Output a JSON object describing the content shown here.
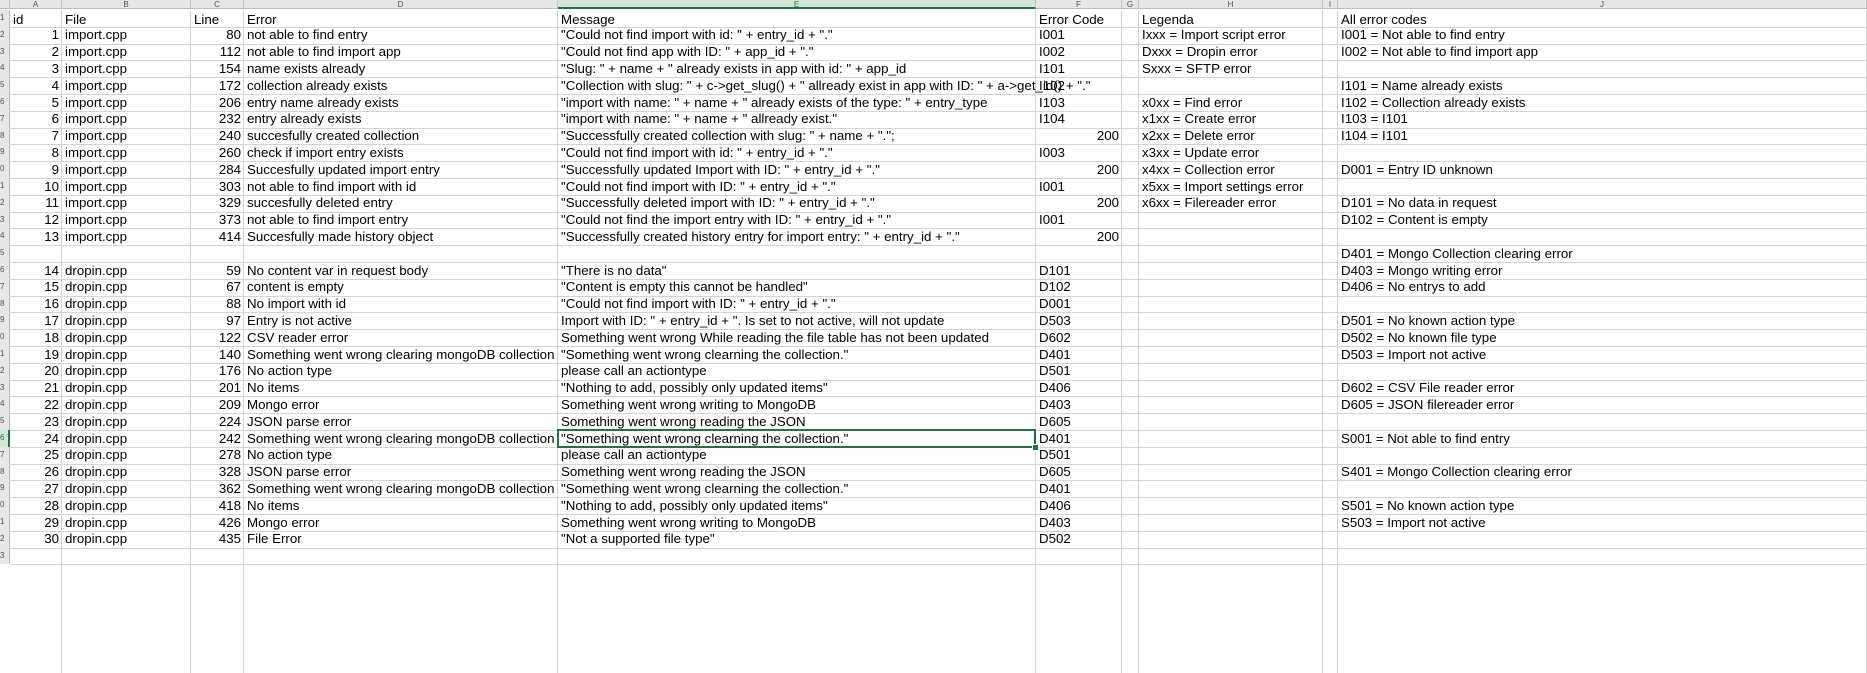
{
  "spreadsheet": {
    "column_letters": [
      "A",
      "B",
      "C",
      "D",
      "E",
      "F",
      "G",
      "H",
      "I",
      "J"
    ],
    "selected_column": "E",
    "selected_row": 26,
    "row_numbers": [
      "1",
      "2",
      "3",
      "4",
      "5",
      "6",
      "7",
      "8",
      "9",
      "0",
      "1",
      "2",
      "3",
      "4",
      "5",
      "6",
      "7",
      "8",
      "9",
      "0",
      "1",
      "2",
      "3",
      "4",
      "5",
      "6",
      "7",
      "8",
      "9",
      "0",
      "1",
      "2",
      "3"
    ],
    "headers": {
      "id": "id",
      "file": "File",
      "line": "Line",
      "error": "Error",
      "message": "Message",
      "error_code": "Error Code",
      "legenda": "Legenda",
      "all_error_codes": "All error codes"
    },
    "colors": {
      "accent": "#217346",
      "header_bg": "#e6e6e6",
      "grid": "#d4d4d4"
    },
    "rows": [
      {
        "id": "1",
        "file": "import.cpp",
        "line": "80",
        "error": "not able to find entry",
        "message": "\"Could not find import with id: \" + entry_id + \".\"",
        "code": "I001",
        "status": "",
        "legenda": "Ixxx = Import script error",
        "all": "I001 = Not able to find entry"
      },
      {
        "id": "2",
        "file": "import.cpp",
        "line": "112",
        "error": "not able to find import app",
        "message": "\"Could not find app with ID: \" + app_id + \".\"",
        "code": "I002",
        "status": "",
        "legenda": "Dxxx = Dropin error",
        "all": "I002 = Not able to find import app"
      },
      {
        "id": "3",
        "file": "import.cpp",
        "line": "154",
        "error": "name exists already",
        "message": "\"Slug: \" + name + \" already exists in app with id: \" + app_id",
        "code": "I101",
        "status": "",
        "legenda": "Sxxx = SFTP error",
        "all": ""
      },
      {
        "id": "4",
        "file": "import.cpp",
        "line": "172",
        "error": "collection already exists",
        "message": "\"Collection with slug: \" + c->get_slug() + \" allready exist in app with ID: \" + a->get_id() + \".\"",
        "code": "I102",
        "status": "",
        "legenda": "",
        "all": "I101 = Name already exists"
      },
      {
        "id": "5",
        "file": "import.cpp",
        "line": "206",
        "error": "entry name already exists",
        "message": "\"import with name: \" + name + \" already exists of the type: \" + entry_type",
        "code": "I103",
        "status": "",
        "legenda": "x0xx = Find error",
        "all": "I102 = Collection already exists"
      },
      {
        "id": "6",
        "file": "import.cpp",
        "line": "232",
        "error": "entry already exists",
        "message": "\"import with name: \" + name + \" allready exist.\"",
        "code": "I104",
        "status": "",
        "legenda": "x1xx = Create error",
        "all": "I103 = I101"
      },
      {
        "id": "7",
        "file": "import.cpp",
        "line": "240",
        "error": "succesfully created collection",
        "message": "\"Successfully created collection with slug: \" + name + \".\";",
        "code": "",
        "status": "200",
        "legenda": "x2xx = Delete error",
        "all": "I104 = I101"
      },
      {
        "id": "8",
        "file": "import.cpp",
        "line": "260",
        "error": "check if import entry exists",
        "message": "\"Could not find import with id: \" + entry_id + \".\"",
        "code": "I003",
        "status": "",
        "legenda": "x3xx = Update error",
        "all": ""
      },
      {
        "id": "9",
        "file": "import.cpp",
        "line": "284",
        "error": "Succesfully updated import entry",
        "message": "\"Successfully updated Import with ID: \" + entry_id + \".\"",
        "code": "",
        "status": "200",
        "legenda": "x4xx = Collection error",
        "all": "D001 = Entry ID unknown"
      },
      {
        "id": "10",
        "file": "import.cpp",
        "line": "303",
        "error": "not able to find import with id",
        "message": "\"Could not find import with ID: \" + entry_id + \".\"",
        "code": "I001",
        "status": "",
        "legenda": "x5xx = Import settings error",
        "all": ""
      },
      {
        "id": "11",
        "file": "import.cpp",
        "line": "329",
        "error": "succesfully deleted entry",
        "message": "\"Successfully deleted import with ID: \" + entry_id + \".\"",
        "code": "",
        "status": "200",
        "legenda": "x6xx = Filereader error",
        "all": "D101 = No data in request"
      },
      {
        "id": "12",
        "file": "import.cpp",
        "line": "373",
        "error": "not able to find import entry",
        "message": "\"Could not find the import entry with ID: \" + entry_id + \".\"",
        "code": "I001",
        "status": "",
        "legenda": "",
        "all": "D102 = Content is empty"
      },
      {
        "id": "13",
        "file": "import.cpp",
        "line": "414",
        "error": "Succesfully made history object",
        "message": "\"Successfully created history entry for import entry: \" + entry_id + \".\"",
        "code": "",
        "status": "200",
        "legenda": "",
        "all": ""
      },
      {
        "id": "",
        "file": "",
        "line": "",
        "error": "",
        "message": "",
        "code": "",
        "status": "",
        "legenda": "",
        "all": "D401 = Mongo Collection clearing error"
      },
      {
        "id": "14",
        "file": "dropin.cpp",
        "line": "59",
        "error": "No content var in request body",
        "message": "\"There is no data\"",
        "code": "D101",
        "status": "",
        "legenda": "",
        "all": "D403 = Mongo writing error"
      },
      {
        "id": "15",
        "file": "dropin.cpp",
        "line": "67",
        "error": "content is empty",
        "message": "\"Content is empty this cannot be handled\"",
        "code": "D102",
        "status": "",
        "legenda": "",
        "all": "D406 = No entrys to add"
      },
      {
        "id": "16",
        "file": "dropin.cpp",
        "line": "88",
        "error": "No import with id",
        "message": "\"Could not find import with ID: \" + entry_id + \".\"",
        "code": "D001",
        "status": "",
        "legenda": "",
        "all": ""
      },
      {
        "id": "17",
        "file": "dropin.cpp",
        "line": "97",
        "error": "Entry is not active",
        "message": "Import with ID: \" + entry_id + \". Is set to not active, will not update",
        "code": "D503",
        "status": "",
        "legenda": "",
        "all": "D501 = No known action type"
      },
      {
        "id": "18",
        "file": "dropin.cpp",
        "line": "122",
        "error": "CSV reader error",
        "message": "Something went wrong While reading the file table has not been updated",
        "code": "D602",
        "status": "",
        "legenda": "",
        "all": "D502 = No known file type"
      },
      {
        "id": "19",
        "file": "dropin.cpp",
        "line": "140",
        "error": "Something went wrong clearing mongoDB collection",
        "message": "\"Something went wrong clearning the collection.\"",
        "code": "D401",
        "status": "",
        "legenda": "",
        "all": "D503 = Import not active"
      },
      {
        "id": "20",
        "file": "dropin.cpp",
        "line": "176",
        "error": "No action type",
        "message": "please call an actiontype",
        "code": "D501",
        "status": "",
        "legenda": "",
        "all": ""
      },
      {
        "id": "21",
        "file": "dropin.cpp",
        "line": "201",
        "error": "No items",
        "message": "\"Nothing to add, possibly only updated items\"",
        "code": "D406",
        "status": "",
        "legenda": "",
        "all": "D602 = CSV File reader error"
      },
      {
        "id": "22",
        "file": "dropin.cpp",
        "line": "209",
        "error": "Mongo error",
        "message": "Something went wrong writing to MongoDB",
        "code": "D403",
        "status": "",
        "legenda": "",
        "all": "D605 = JSON filereader error"
      },
      {
        "id": "23",
        "file": "dropin.cpp",
        "line": "224",
        "error": "JSON parse error",
        "message": "Something went wrong reading the JSON",
        "code": "D605",
        "status": "",
        "legenda": "",
        "all": ""
      },
      {
        "id": "24",
        "file": "dropin.cpp",
        "line": "242",
        "error": "Something went wrong clearing mongoDB collection",
        "message": "\"Something went wrong clearning the collection.\"",
        "code": "D401",
        "status": "",
        "legenda": "",
        "all": "S001 = Not able to find entry"
      },
      {
        "id": "25",
        "file": "dropin.cpp",
        "line": "278",
        "error": "No action type",
        "message": "please call an actiontype",
        "code": "D501",
        "status": "",
        "legenda": "",
        "all": ""
      },
      {
        "id": "26",
        "file": "dropin.cpp",
        "line": "328",
        "error": "JSON parse error",
        "message": "Something went wrong reading the JSON",
        "code": "D605",
        "status": "",
        "legenda": "",
        "all": "S401 = Mongo Collection clearing error"
      },
      {
        "id": "27",
        "file": "dropin.cpp",
        "line": "362",
        "error": "Something went wrong clearing mongoDB collection",
        "message": "\"Something went wrong clearning the collection.\"",
        "code": "D401",
        "status": "",
        "legenda": "",
        "all": ""
      },
      {
        "id": "28",
        "file": "dropin.cpp",
        "line": "418",
        "error": "No items",
        "message": "\"Nothing to add, possibly only updated items\"",
        "code": "D406",
        "status": "",
        "legenda": "",
        "all": "S501 = No known action type"
      },
      {
        "id": "29",
        "file": "dropin.cpp",
        "line": "426",
        "error": "Mongo error",
        "message": "Something went wrong writing to MongoDB",
        "code": "D403",
        "status": "",
        "legenda": "",
        "all": "S503 = Import not active"
      },
      {
        "id": "30",
        "file": "dropin.cpp",
        "line": "435",
        "error": "File Error",
        "message": "\"Not a supported file type\"",
        "code": "D502",
        "status": "",
        "legenda": "",
        "all": ""
      }
    ]
  }
}
